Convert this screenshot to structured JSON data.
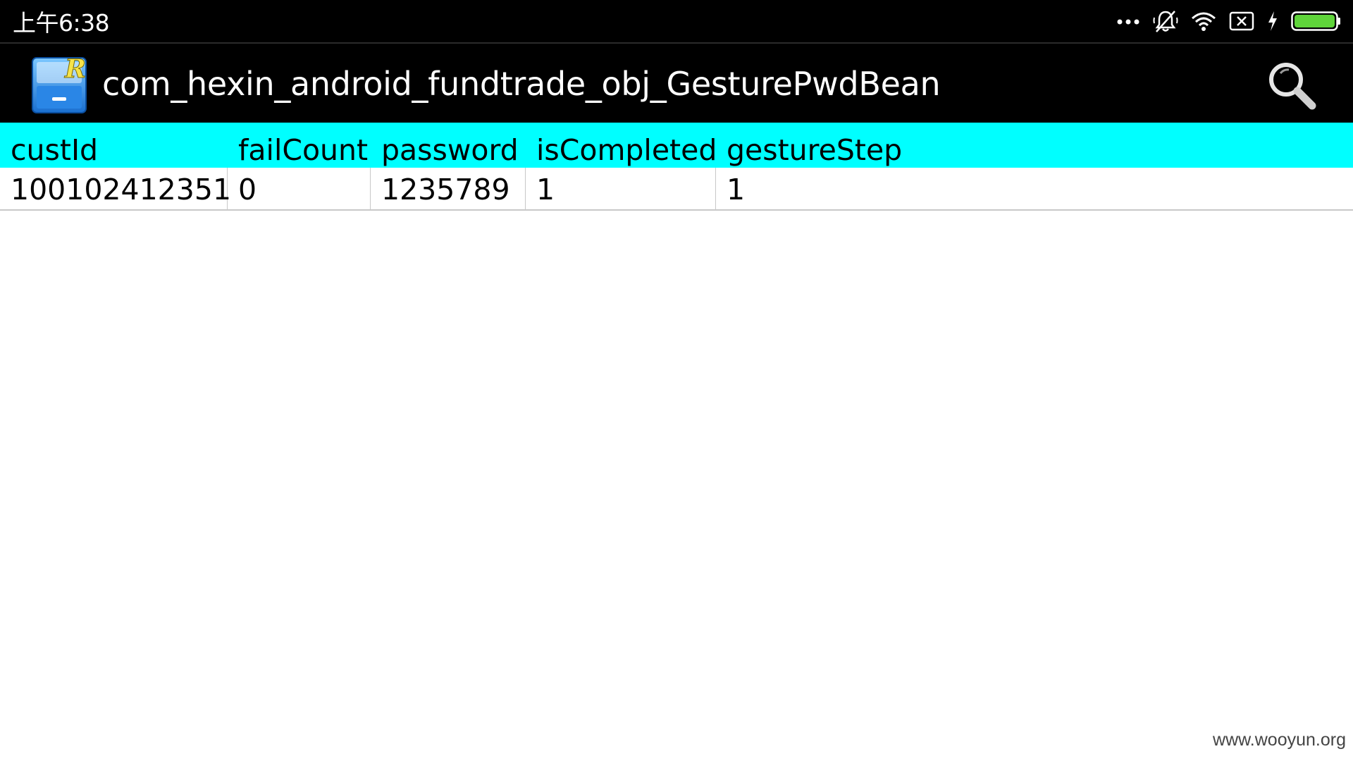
{
  "status_bar": {
    "time": "上午6:38",
    "icons": [
      "more-dots-icon",
      "silent-bell-icon",
      "wifi-icon",
      "no-sim-icon",
      "charging-bolt-icon",
      "battery-icon"
    ],
    "battery_color": "#5fd43a"
  },
  "app_bar": {
    "icon": "file-cabinet-r-icon",
    "title": "com_hexin_android_fundtrade_obj_GesturePwdBean",
    "search_icon": "search-icon"
  },
  "table": {
    "header_color": "#00ffff",
    "columns": [
      "custId",
      "failCount",
      "password",
      "isCompleted",
      "gestureStep"
    ],
    "rows": [
      [
        "100102412351",
        "0",
        "1235789",
        "1",
        "1"
      ]
    ]
  },
  "watermark": "www.wooyun.org"
}
